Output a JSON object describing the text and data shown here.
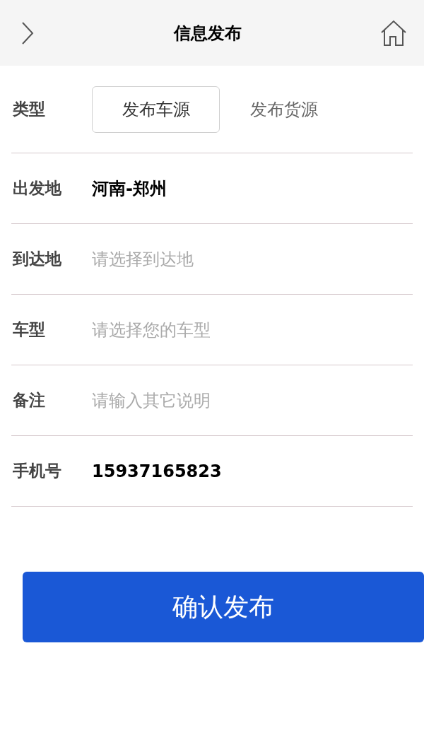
{
  "header": {
    "title": "信息发布"
  },
  "type_row": {
    "label": "类型",
    "options": [
      {
        "label": "发布车源",
        "selected": true
      },
      {
        "label": "发布货源",
        "selected": false
      }
    ]
  },
  "fields": [
    {
      "label": "出发地",
      "value": "河南-郑州"
    },
    {
      "label": "到达地",
      "placeholder": "请选择到达地"
    },
    {
      "label": "车型",
      "placeholder": "请选择您的车型"
    },
    {
      "label": "备注",
      "placeholder": "请输入其它说明"
    },
    {
      "label": "手机号",
      "value": "15937165823"
    }
  ],
  "submit": "确认发布"
}
